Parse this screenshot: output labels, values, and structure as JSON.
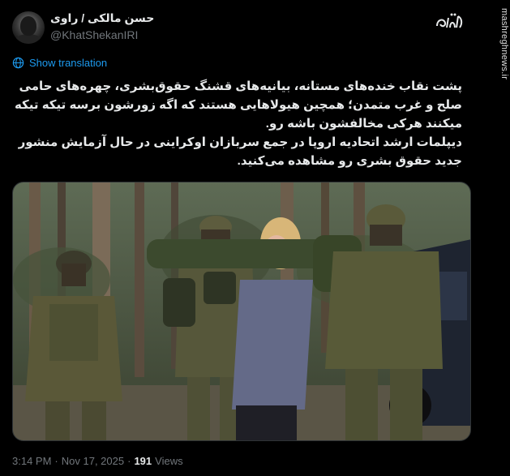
{
  "tweet": {
    "author": {
      "display_name": "حسن مالکی / راوی",
      "handle": "@KhatShekanIRI"
    },
    "translate_link": "Show translation",
    "text": "پشت نقاب خنده‌های مستانه، بیانیه‌های قشنگ حقوق‌بشری، چهره‌های حامی صلح و غرب متمدن؛ همچین هیولاهایی هستند که اگه زورشون برسه تیکه تیکه میکنند هرکی مخالفشون باشه رو.\nدیپلمات ارشد اتحادیه اروپا در جمع سربازان اوکراینی در حال آزمایش منشور جدید حقوق بشری رو مشاهده می‌کنید.",
    "meta": {
      "time": "3:14 PM",
      "separator1": "·",
      "date": "Nov 17, 2025",
      "separator2": "·",
      "views_count": "191",
      "views_label": "Views"
    }
  },
  "brand": {
    "logo_text": "مشرق",
    "icon": "mashregh-logo-icon"
  },
  "watermark": {
    "text": "mashreghnews.ir"
  },
  "icons": {
    "translate": "globe-icon"
  },
  "colors": {
    "background": "#000000",
    "text": "#e7e9ea",
    "secondary": "#71767b",
    "link": "#1d9bf0"
  }
}
